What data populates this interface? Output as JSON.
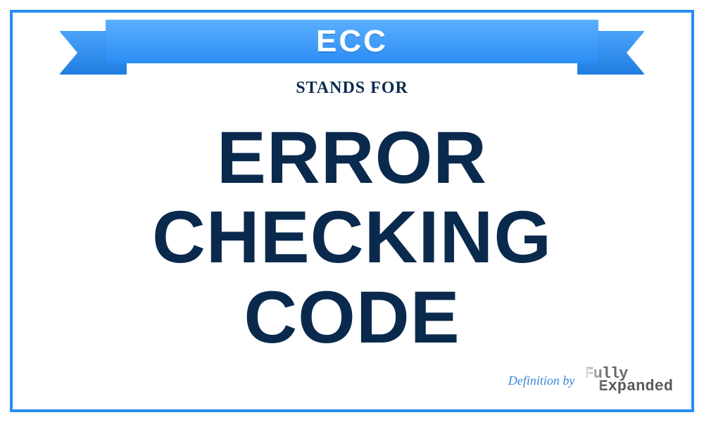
{
  "acronym": "ECC",
  "stands_for_label": "STANDS FOR",
  "definition": "ERROR CHECKING CODE",
  "credit": {
    "prefix": "Definition by",
    "logo_top": "Fully",
    "logo_bottom": "Expanded"
  },
  "colors": {
    "accent_blue": "#2a8cf4",
    "dark_navy": "#0a2a4d"
  }
}
